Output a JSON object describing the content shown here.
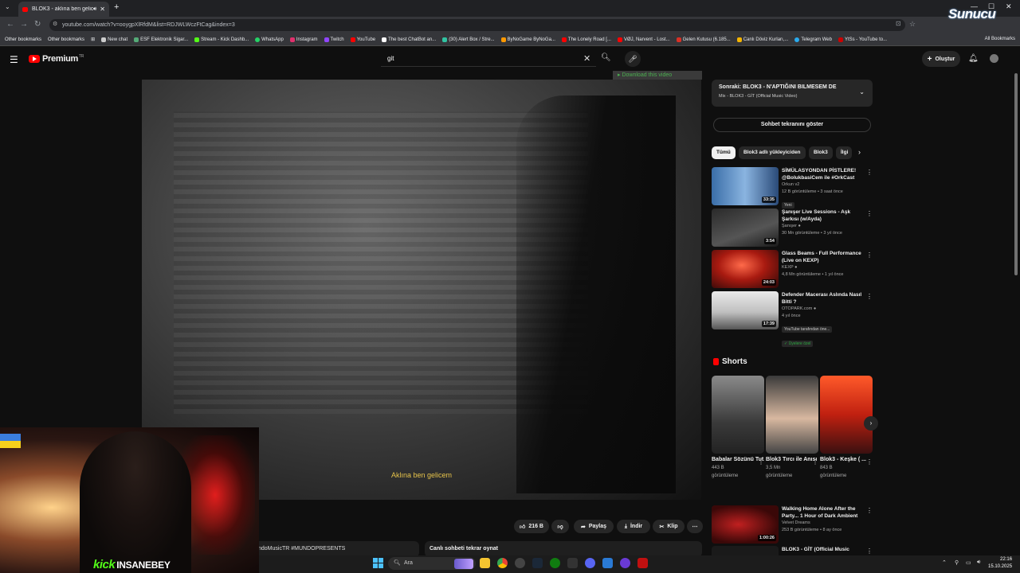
{
  "browser": {
    "tab_title": "BLOK3 - aklına ben gelicem",
    "url": "youtube.com/watch?v=ooygpXlRfdM&list=RDJWLWczFtCag&index=3",
    "bookmarks": [
      "Other bookmarks",
      "Other bookmarks",
      "New chat",
      "ESF Elektronik Sigar...",
      "Stream - Kick Dashb...",
      "WhatsApp",
      "Instagram",
      "Twitch",
      "YouTube",
      "The best ChatBot an...",
      "(30) Alert Box / Stre...",
      "ByNoGame ByNoGa...",
      "The Lonely Road [...",
      "VØJ, Narvent - Lost...",
      "Gelen Kutusu (6.185...",
      "Canlı Döviz Kurları,...",
      "Telegram Web",
      "YtSs - YouTube to..."
    ],
    "all_bookmarks": "All Bookmarks",
    "overlay_logo": "Sunucu"
  },
  "youtube": {
    "logo_text": "Premium",
    "logo_region": "TR",
    "search_value": "git",
    "create_label": "Oluştur"
  },
  "video": {
    "subtitle": "Aklına ben gelicem",
    "download_banner": "Download this video"
  },
  "actions": {
    "likes": "216 B",
    "share": "Paylaş",
    "download": "İndir",
    "clip": "Klip"
  },
  "chat": {
    "left_text": "ndoMusicTR #MUNDOPRESENTS",
    "replay": "Canlı sohbeti tekrar oynat"
  },
  "sidebar": {
    "upnext_title": "Sonraki: BLOK3 - N'APTIĞINI BILMESEM DE",
    "upnext_sub": "Mix - BLOK3 - GİT (Official Music Video)",
    "chat_button": "Sohbet tekranını göster",
    "chips": [
      "Tümü",
      "Blok3 adlı yükleyiciden",
      "Blok3",
      "İlgi"
    ],
    "recs": [
      {
        "title": "SİMÜLASYONDAN PİSTLERE! @BolukbasiCem ile #OrkCast",
        "channel": "Orkun v2",
        "meta": "12 B görüntüleme • 3 saat önce",
        "duration": "33:35",
        "badge": "Yeni"
      },
      {
        "title": "Şanışer Live Sessions - Aşk Şarkısı (w/Ayda)",
        "channel": "Şanışer",
        "meta": "30 Mn görüntüleme • 3 yıl önce",
        "duration": "3:54",
        "badge": ""
      },
      {
        "title": "Glass Beams - Full Performance (Live on KEXP)",
        "channel": "KEXP",
        "meta": "4,8 Mn görüntüleme • 1 yıl önce",
        "duration": "24:03",
        "badge": ""
      },
      {
        "title": "Defender Macerası Aslında Nasıl Bitti ?",
        "channel": "OTOPARK.com",
        "meta": "4 yıl önce",
        "duration": "17:39",
        "badge": "YouTube tarafından öne...",
        "badge2": "Üyelere özel"
      }
    ],
    "shorts_label": "Shorts",
    "shorts": [
      {
        "title": "Babalar Sözünü Tut...",
        "views": "443 B",
        "views_label": "görüntüleme"
      },
      {
        "title": "Blok3 Tırcı ile Anısı 😂...",
        "views": "3,5 Mn",
        "views_label": "görüntüleme"
      },
      {
        "title": "Blok3 - Keşke ( ...",
        "views": "843 B",
        "views_label": "görüntüleme"
      }
    ],
    "recs2": [
      {
        "title": "Walking Home Alone After the Party... 1 Hour of Dark Ambient",
        "channel": "Velvet Dreams",
        "meta": "253 B görüntüleme • 8 ay önce",
        "duration": "1:00:26"
      },
      {
        "title": "BLOK3 - GİT (Official Music",
        "channel": "",
        "meta": "",
        "duration": ""
      }
    ]
  },
  "stream": {
    "platform": "kick",
    "username": "INSANEBEY"
  },
  "taskbar": {
    "search": "Ara",
    "time": "22:16",
    "date": "15.10.2025"
  },
  "colors": {
    "yt_red": "#ff0000",
    "subtitle": "#e6c34a",
    "kick_green": "#53fc18"
  }
}
